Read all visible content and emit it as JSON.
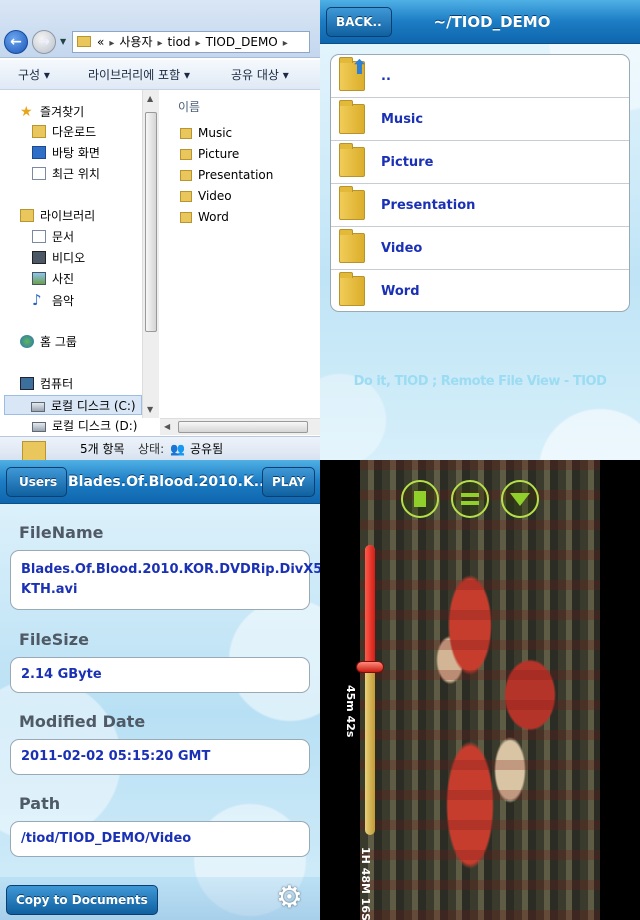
{
  "explorer": {
    "address": [
      "«",
      "사용자",
      "tiod",
      "TIOD_DEMO"
    ],
    "commands": [
      "구성 ▾",
      "라이브러리에 포함 ▾",
      "공유 대상 ▾"
    ],
    "nav": {
      "favorites": "즐겨찾기",
      "downloads": "다운로드",
      "desktop": "바탕 화면",
      "recent": "최근 위치",
      "libraries": "라이브러리",
      "documents": "문서",
      "videos": "비디오",
      "pictures": "사진",
      "music": "음악",
      "homegroup": "홈 그룹",
      "computer": "컴퓨터",
      "local_c": "로컬 디스크 (C:)",
      "local_d": "로컬 디스크 (D:)"
    },
    "column_header": "이름",
    "files": [
      "Music",
      "Picture",
      "Presentation",
      "Video",
      "Word"
    ],
    "status": {
      "count": "5개 항목",
      "state_label": "상태:",
      "state_value": "공유됨"
    }
  },
  "browser": {
    "back_label": "BACK..",
    "title": "~/TIOD_DEMO",
    "rows": [
      "..",
      "Music",
      "Picture",
      "Presentation",
      "Video",
      "Word"
    ],
    "footer": "Do it, TIOD ; Remote File View - TIOD"
  },
  "detail": {
    "back_label": "Users",
    "title": "Blades.Of.Blood.2010.K...",
    "play_label": "PLAY",
    "filename_label": "FileName",
    "filename_value": "Blades.Of.Blood.2010.KOR.DVDRip.DivX5-KTH.avi",
    "filesize_label": "FileSize",
    "filesize_value": "2.14 GByte",
    "modified_label": "Modified Date",
    "modified_value": "2011-02-02 05:15:20 GMT",
    "path_label": "Path",
    "path_value": "/tiod/TIOD_DEMO/Video",
    "copy_label": "Copy to Documents"
  },
  "video": {
    "elapsed": "45m 42s",
    "duration": "1H 48M 16S",
    "progress": 0.42,
    "colors": {
      "accent": "#8fd12a",
      "seek_fill": "#e52a1e",
      "seek_track": "#d8b653"
    }
  }
}
